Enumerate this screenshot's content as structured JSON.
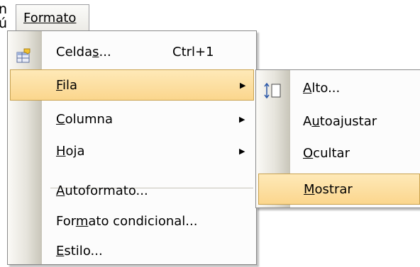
{
  "left_fragments": [
    "n",
    "ú"
  ],
  "menubar": {
    "label": "Formato"
  },
  "main_menu": [
    {
      "id": "celdas",
      "label_pre": "Celda",
      "label_ul": "s",
      "label_post": "...",
      "accel": "Ctrl+1",
      "submenu": false
    },
    {
      "id": "fila",
      "label_pre": "",
      "label_ul": "F",
      "label_post": "ila",
      "accel": "",
      "submenu": true
    },
    {
      "id": "columna",
      "label_pre": "",
      "label_ul": "C",
      "label_post": "olumna",
      "accel": "",
      "submenu": true
    },
    {
      "id": "hoja",
      "label_pre": "",
      "label_ul": "H",
      "label_post": "oja",
      "accel": "",
      "submenu": true
    },
    {
      "id": "autoformato",
      "label_pre": "",
      "label_ul": "A",
      "label_post": "utoformato...",
      "accel": "",
      "submenu": false
    },
    {
      "id": "formato-condicional",
      "label_pre": "For",
      "label_ul": "m",
      "label_post": "ato condicional...",
      "accel": "",
      "submenu": false
    },
    {
      "id": "estilo",
      "label_pre": "",
      "label_ul": "E",
      "label_post": "stilo...",
      "accel": "",
      "submenu": false
    }
  ],
  "sub_menu": [
    {
      "id": "alto",
      "label_pre": "",
      "label_ul": "A",
      "label_post": "lto...",
      "has_icon": true
    },
    {
      "id": "autoajustar",
      "label_pre": "A",
      "label_ul": "u",
      "label_post": "toajustar",
      "has_icon": false
    },
    {
      "id": "ocultar",
      "label_pre": "",
      "label_ul": "O",
      "label_post": "cultar",
      "has_icon": false
    },
    {
      "id": "mostrar",
      "label_pre": "",
      "label_ul": "M",
      "label_post": "ostrar",
      "has_icon": false
    }
  ],
  "highlighted": {
    "main": "fila",
    "sub": "mostrar"
  },
  "icons": {
    "celdas": "cell-format-icon",
    "alto": "row-height-icon",
    "submenu": "submenu-arrow-icon"
  },
  "colors": {
    "highlight_top": "#fee9b8",
    "highlight_bottom": "#fbd68d",
    "highlight_border": "#c9a24f"
  }
}
